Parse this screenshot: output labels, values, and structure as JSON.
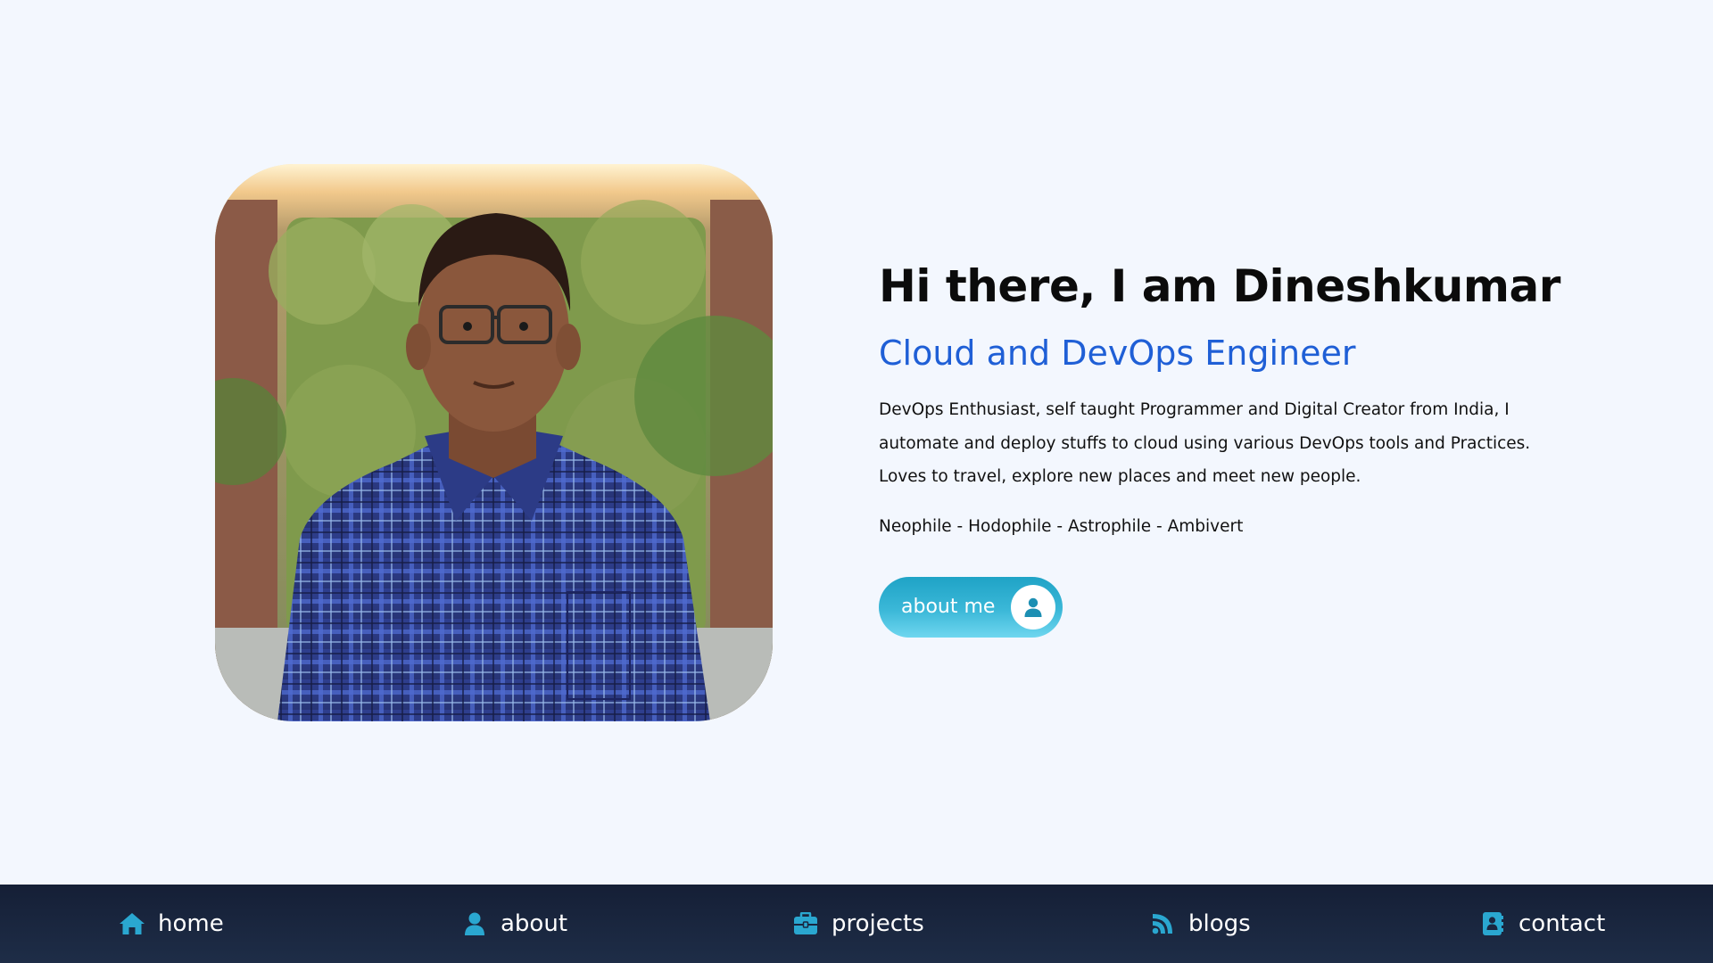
{
  "hero": {
    "greeting": "Hi there, I am Dineshkumar",
    "role": "Cloud and DevOps Engineer",
    "bio": "DevOps Enthusiast, self taught Programmer and Digital Creator from India, I automate and deploy stuffs to cloud using various DevOps tools and Practices. Loves to travel, explore new places and meet new people.",
    "tagline": "Neophile - Hodophile - Astrophile - Ambivert",
    "about_button": {
      "label": "about me",
      "icon": "user-icon"
    },
    "photo": {
      "icon": "profile-photo"
    }
  },
  "nav": {
    "items": [
      {
        "label": "home",
        "icon": "home-icon"
      },
      {
        "label": "about",
        "icon": "user-icon"
      },
      {
        "label": "projects",
        "icon": "briefcase-icon"
      },
      {
        "label": "blogs",
        "icon": "rss-icon"
      },
      {
        "label": "contact",
        "icon": "address-book-icon"
      }
    ]
  },
  "colors": {
    "background": "#f3f7fe",
    "accent": "#1f5fd6",
    "button": "#3bb8d8",
    "nav_bg": "#1a2640",
    "nav_icon": "#2aa7d0"
  }
}
